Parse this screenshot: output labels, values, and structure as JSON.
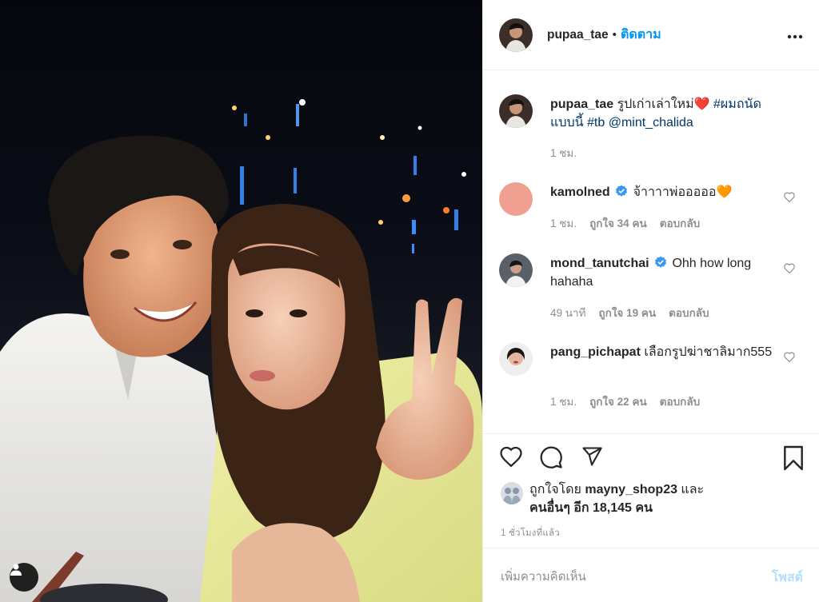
{
  "post": {
    "author": "pupaa_tae",
    "dot": "•",
    "follow_label": "ติดตาม",
    "more_label": "•••",
    "caption": {
      "user": "pupaa_tae",
      "text": " รูปเก่าเล่าใหม่",
      "heart": "❤️",
      "hashtag1": " #ผมถนัดแบบนี้",
      "hashtag2": " #tb",
      "mention": " @mint_chalida",
      "time": "1 ชม."
    },
    "comments": [
      {
        "user": "kamolned",
        "verified": true,
        "text": " จ้าาาาพ่อออออ🧡",
        "time": "1 ชม.",
        "likes": "ถูกใจ 34 คน",
        "reply": "ตอบกลับ"
      },
      {
        "user": "mond_tanutchai",
        "verified": true,
        "text": " Ohh how long hahaha",
        "time": "49 นาที",
        "likes": "ถูกใจ 19 คน",
        "reply": "ตอบกลับ"
      },
      {
        "user": "pang_pichapat",
        "verified": false,
        "text": " เลือกรูปฆ่าชาลิมาก555",
        "time": "1 ชม.",
        "likes": "ถูกใจ 22 คน",
        "reply": "ตอบกลับ"
      }
    ],
    "liked_by": {
      "prefix": "ถูกใจโดย ",
      "user": "mayny_shop23",
      "and": " และ",
      "others": "คนอื่นๆ อีก 18,145 คน"
    },
    "time_ago": "1 ชั่วโมงที่แล้ว",
    "add_comment_placeholder": "เพิ่มความคิดเห็น",
    "post_label": "โพสต์"
  },
  "icons": {
    "heart": "heart-icon",
    "comment": "comment-icon",
    "share": "share-icon",
    "save": "bookmark-icon",
    "more": "more-icon",
    "verified": "verified-badge-icon",
    "user_tag": "user-tag-icon"
  },
  "colors": {
    "accent": "#0095f6",
    "link": "#00376b",
    "muted": "#8e8e8e",
    "post_disabled": "#b2dffc",
    "verified": "#3897f0"
  }
}
